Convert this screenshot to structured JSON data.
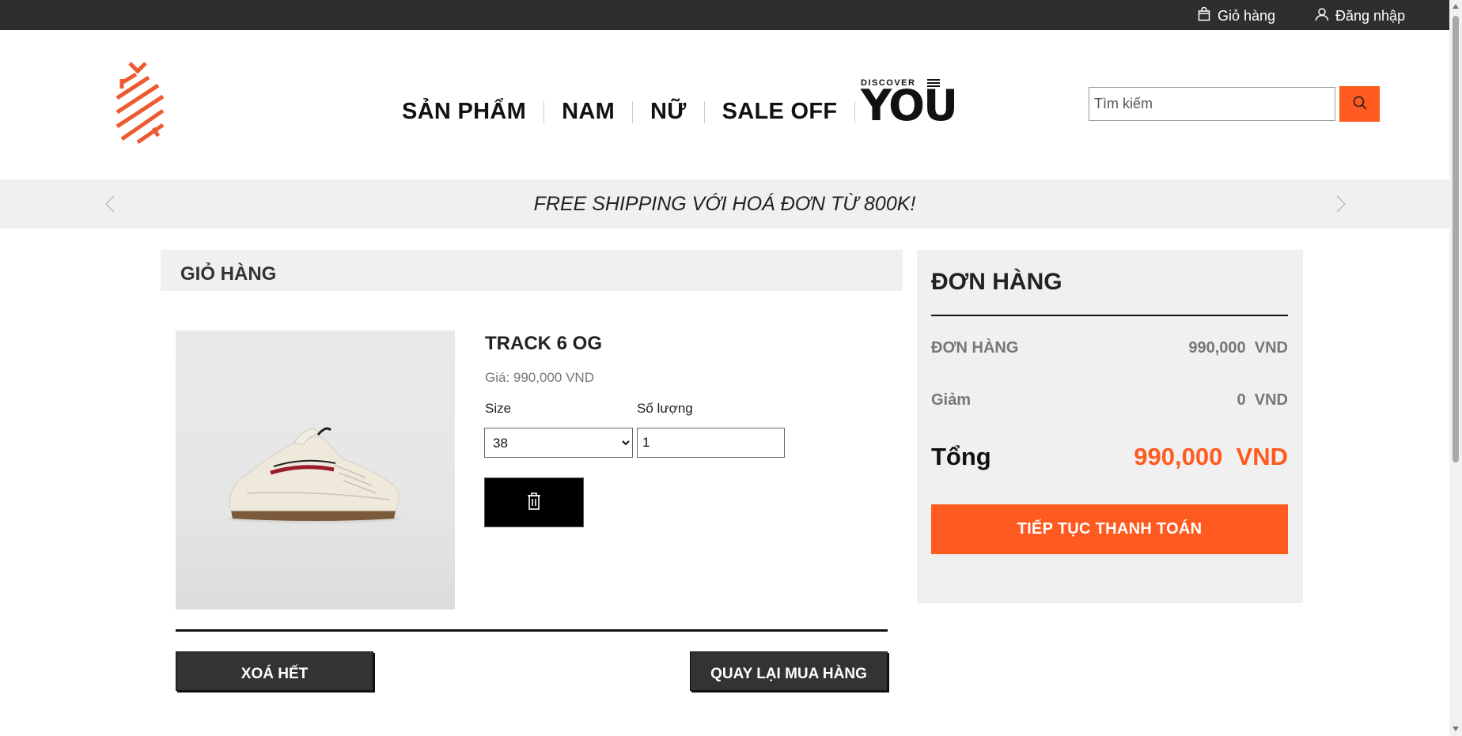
{
  "topbar": {
    "cart_label": "Giỏ hàng",
    "login_label": "Đăng nhập"
  },
  "header": {
    "nav": [
      "SẢN PHẨM",
      "NAM",
      "NỮ",
      "SALE OFF"
    ],
    "discover_small": "DISCOVER",
    "discover_big": "YOU",
    "search_placeholder": "Tìm kiếm"
  },
  "banner": {
    "message": "FREE SHIPPING VỚI HOÁ ĐƠN TỪ 800K!"
  },
  "cart": {
    "title": "GIỎ HÀNG",
    "item": {
      "name": "TRACK 6 OG",
      "price_text": "Giá: 990,000 VND",
      "size_label": "Size",
      "qty_label": "Số lượng",
      "size_value": "38",
      "qty_value": "1"
    },
    "clear_all_label": "XOÁ HẾT",
    "back_label": "QUAY LẠI MUA HÀNG"
  },
  "order": {
    "title": "ĐƠN HÀNG",
    "subtotal_label": "ĐƠN HÀNG",
    "subtotal_value": "990,000  VND",
    "discount_label": "Giảm",
    "discount_value": "0  VND",
    "total_label": "Tổng",
    "total_value": "990,000  VND",
    "checkout_label": "TIẾP TỤC THANH TOÁN"
  },
  "colors": {
    "accent": "#ff5a1f",
    "topbar": "#2e2e2e",
    "panel": "#f0f0f0"
  }
}
